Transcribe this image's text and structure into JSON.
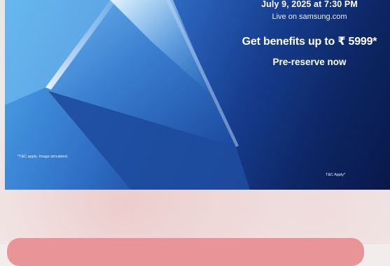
{
  "banner": {
    "date_line": "July 9, 2025 at 7:30 PM",
    "live_line": "Live on samsung.com",
    "benefit_line": "Get benefits up to ₹ 5999*",
    "cta_line": "Pre-reserve now",
    "fineprint": "*T&C apply. Image simulated.",
    "tc_apply": "T&C Apply*"
  },
  "colors": {
    "banner_light_blue": "#4fa8ea",
    "banner_dark_navy": "#09184a",
    "card_pink": "#e99496",
    "page_background": "#f2ecec"
  }
}
